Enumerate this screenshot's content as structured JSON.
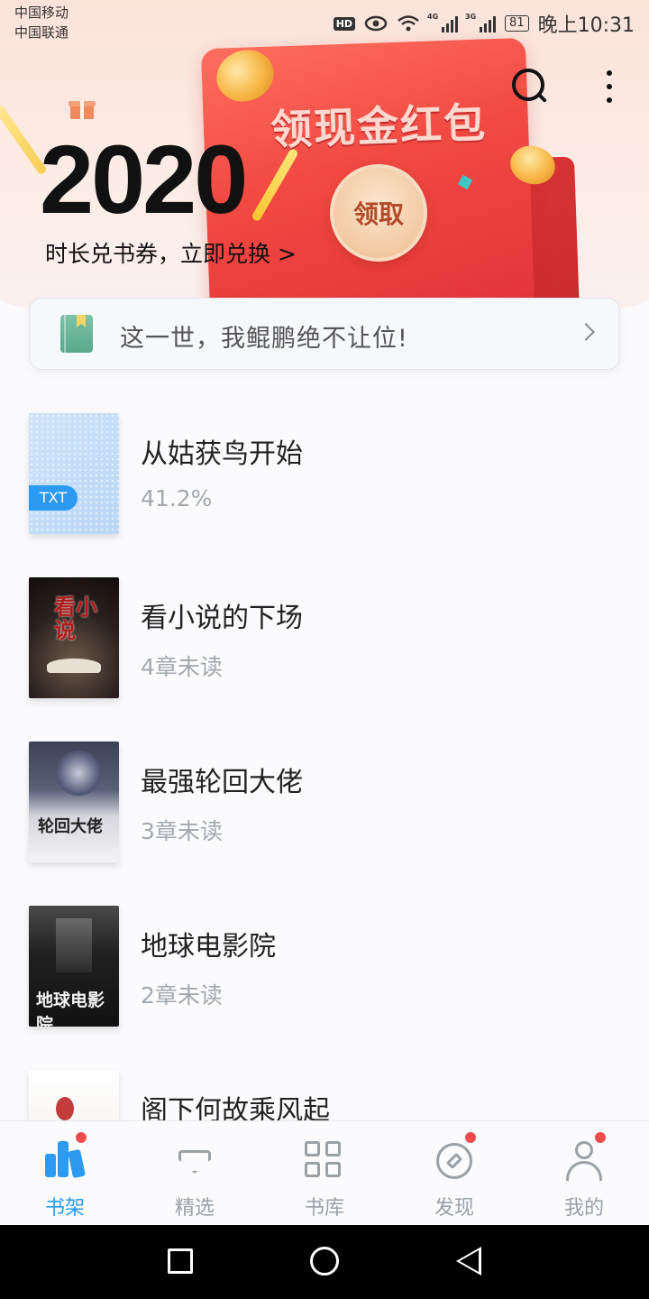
{
  "status_bar": {
    "carrier_1": "中国移动",
    "carrier_2": "中国联通",
    "hd": "HD",
    "net_1": "4G",
    "net_2": "3G",
    "battery": "81",
    "time": "晚上10:31"
  },
  "banner": {
    "year": "2020",
    "redeem_text": "时长兑书券，立即兑换 >",
    "red_packet_title": "领现金红包",
    "claim_label": "领取"
  },
  "recent": {
    "title": "这一世，我鲲鹏绝不让位!"
  },
  "books": [
    {
      "title": "从姑获鸟开始",
      "status": "41.2%",
      "badge": "TXT"
    },
    {
      "title": "看小说的下场",
      "status": "4章未读"
    },
    {
      "title": "最强轮回大佬",
      "status": "3章未读"
    },
    {
      "title": "地球电影院",
      "status": "2章未读"
    },
    {
      "title": "阁下何故乘风起",
      "status": ""
    }
  ],
  "nav": [
    {
      "label": "书架",
      "active": true,
      "badge": true
    },
    {
      "label": "精选",
      "active": false,
      "badge": false
    },
    {
      "label": "书库",
      "active": false,
      "badge": false
    },
    {
      "label": "发现",
      "active": false,
      "badge": true
    },
    {
      "label": "我的",
      "active": false,
      "badge": true
    }
  ],
  "colors": {
    "accent": "#2c9af0",
    "badge_red": "#f04b4b",
    "banner_red": "#f14942"
  }
}
